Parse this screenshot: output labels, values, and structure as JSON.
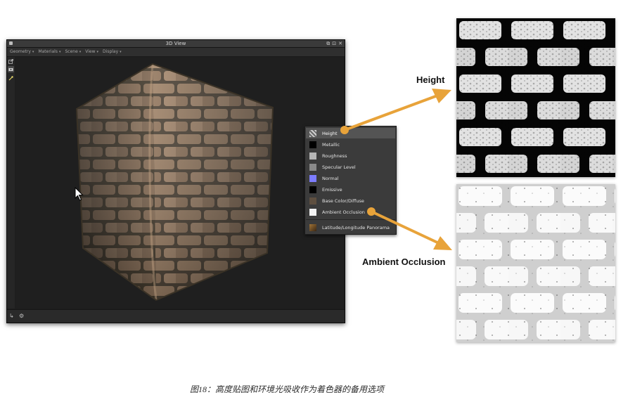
{
  "window": {
    "title": "3D View",
    "menus": [
      "Geometry",
      "Materials",
      "Scene",
      "View",
      "Display"
    ],
    "menu_caret": "▾",
    "window_buttons": [
      "⧉",
      "⊡",
      "✕"
    ]
  },
  "channels": [
    {
      "label": "Height",
      "color": "#9a9a9a",
      "selected": true
    },
    {
      "label": "Metallic",
      "color": "#000000",
      "selected": false
    },
    {
      "label": "Roughness",
      "color": "#b5b5b5",
      "selected": false
    },
    {
      "label": "Specular Level",
      "color": "#8a8a8a",
      "selected": false
    },
    {
      "label": "Normal",
      "color": "#7d7dff",
      "selected": false
    },
    {
      "label": "Emissive",
      "color": "#000000",
      "selected": false
    },
    {
      "label": "Base Color/Diffuse",
      "color": "#5e4f40",
      "selected": false
    },
    {
      "label": "Ambient Occlusion",
      "color": "#f2f2f2",
      "selected": false
    },
    {
      "label": "Latitude/Longitude Panorama",
      "color": "#6a4a24",
      "selected": false
    }
  ],
  "callouts": {
    "height": "Height",
    "ambient_occlusion": "Ambient Occlusion"
  },
  "caption": "图18：高度贴图和环境光吸收作为着色器的备用选项",
  "colors": {
    "arrow": "#e8a33a",
    "viewport_bg": "#1f1f1f",
    "brick_face": "#9c7f65",
    "mortar": "#4f4535"
  }
}
